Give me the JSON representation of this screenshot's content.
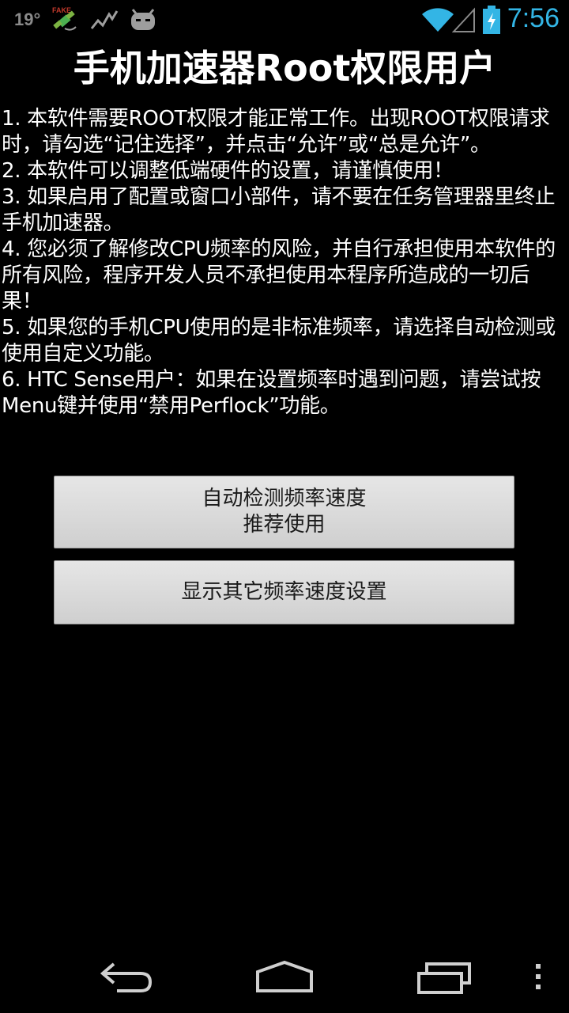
{
  "status_bar": {
    "temperature": "19°",
    "time": "7:56",
    "fake_label": "FAKE",
    "icons": [
      "temperature",
      "fake-gps-icon",
      "activity-graph-icon",
      "cyanogenmod-robot-icon",
      "wifi-icon",
      "cell-signal-icon",
      "battery-charging-icon"
    ]
  },
  "app": {
    "title": "手机加速器Root权限用户"
  },
  "notes": [
    "1. 本软件需要ROOT权限才能正常工作。出现ROOT权限请求时，请勾选“记住选择”，并点击“允许”或“总是允许”。",
    "2. 本软件可以调整低端硬件的设置，请谨慎使用！",
    "3. 如果启用了配置或窗口小部件，请不要在任务管理器里终止手机加速器。",
    "4. 您必须了解修改CPU频率的风险，并自行承担使用本软件的所有风险，程序开发人员不承担使用本程序所造成的一切后果！",
    "5. 如果您的手机CPU使用的是非标准频率，请选择自动检测或使用自定义功能。",
    "6. HTC Sense用户：如果在设置频率时遇到问题，请尝试按Menu键并使用“禁用Perflock”功能。"
  ],
  "buttons": {
    "auto_detect": {
      "line1": "自动检测频率速度",
      "line2": "推荐使用"
    },
    "show_other": {
      "label": "显示其它频率速度设置"
    }
  },
  "navigation": {
    "icons": [
      "back-icon",
      "home-icon",
      "recent-apps-icon",
      "overflow-menu-icon"
    ]
  },
  "colors": {
    "accent": "#33b5e5",
    "background": "#000000",
    "button_face": "#dcdcdc",
    "status_icon_gray": "#8a8a8a"
  }
}
